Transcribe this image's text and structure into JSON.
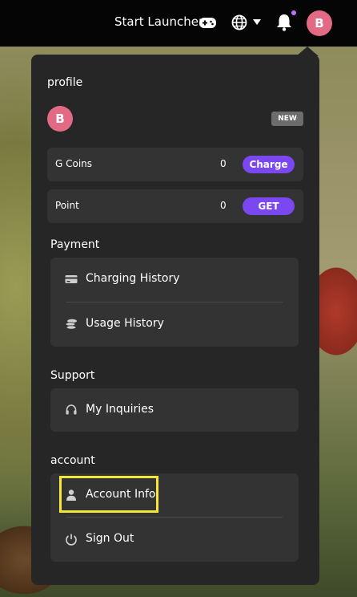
{
  "topbar": {
    "launcher_label": "Start Launcher",
    "avatar_letter": "B"
  },
  "menu": {
    "profile_title": "profile",
    "avatar_letter": "B",
    "new_badge": "NEW",
    "gcoins": {
      "label": "G Coins",
      "value": "0",
      "button": "Charge"
    },
    "point": {
      "label": "Point",
      "value": "0",
      "button": "GET"
    },
    "payment": {
      "title": "Payment",
      "items": [
        {
          "label": "Charging History",
          "icon": "credit-card-icon"
        },
        {
          "label": "Usage History",
          "icon": "coins-icon"
        }
      ]
    },
    "support": {
      "title": "Support",
      "items": [
        {
          "label": "My Inquiries",
          "icon": "headset-icon"
        }
      ]
    },
    "account": {
      "title": "account",
      "items": [
        {
          "label": "Account Info",
          "icon": "user-icon"
        },
        {
          "label": "Sign Out",
          "icon": "power-icon"
        }
      ]
    }
  },
  "colors": {
    "accent": "#7a47f0",
    "avatar": "#e36a84",
    "panel": "#262626",
    "group": "#333333",
    "highlight": "#f5e63a",
    "notification_dot": "#c66cff"
  }
}
